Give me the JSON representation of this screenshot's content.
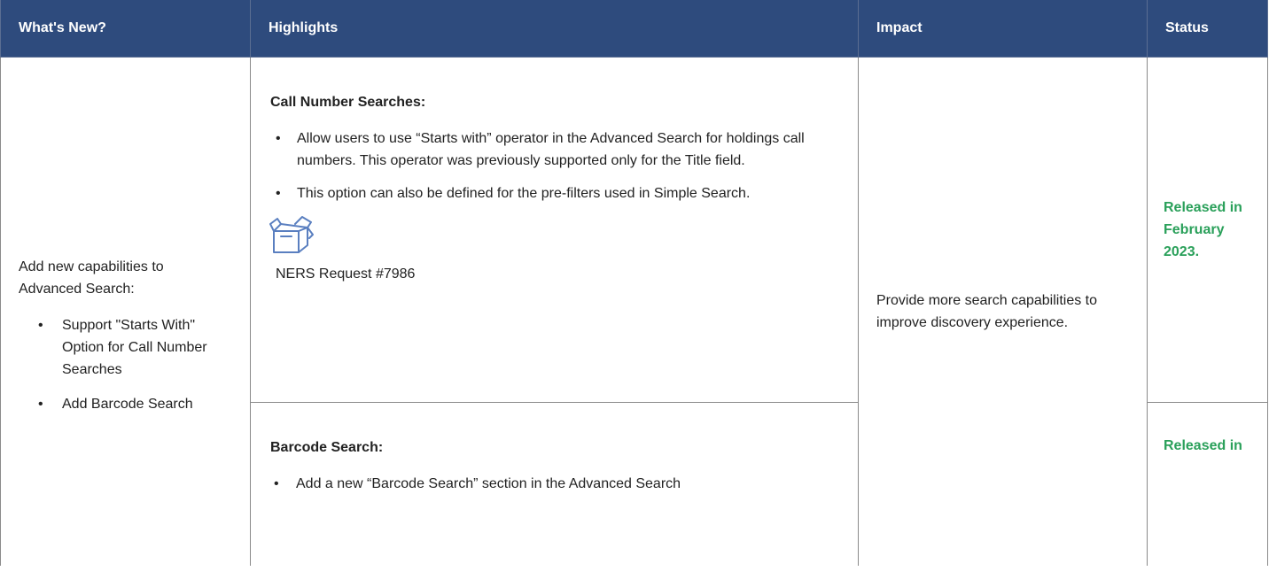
{
  "header": {
    "col_whats_new": "What's New?",
    "col_highlights": "Highlights",
    "col_impact": "Impact",
    "col_status": "Status"
  },
  "row": {
    "whats_new": {
      "intro": "Add new capabilities to Advanced Search:",
      "items": [
        "Support \"Starts With\" Option for Call Number Searches",
        "Add Barcode Search"
      ]
    },
    "impact": "Provide more search capabilities to improve discovery experience.",
    "highlights": [
      {
        "title": "Call Number Searches:",
        "bullets": [
          "Allow users to use “Starts with” operator in the Advanced Search for holdings call numbers. This operator was previously supported only for the Title field.",
          "This option can also be defined for the pre-filters used in Simple Search."
        ],
        "icon": "box-icon",
        "request": "NERS Request #7986",
        "status": "Released in February 2023."
      },
      {
        "title": "Barcode Search:",
        "bullets": [
          "Add a new “Barcode Search” section in the Advanced Search"
        ],
        "status": "Released in"
      }
    ]
  },
  "colors": {
    "header_bg": "#2e4b7d",
    "status_green": "#2aa05a",
    "icon_blue": "#5a7fc0"
  }
}
